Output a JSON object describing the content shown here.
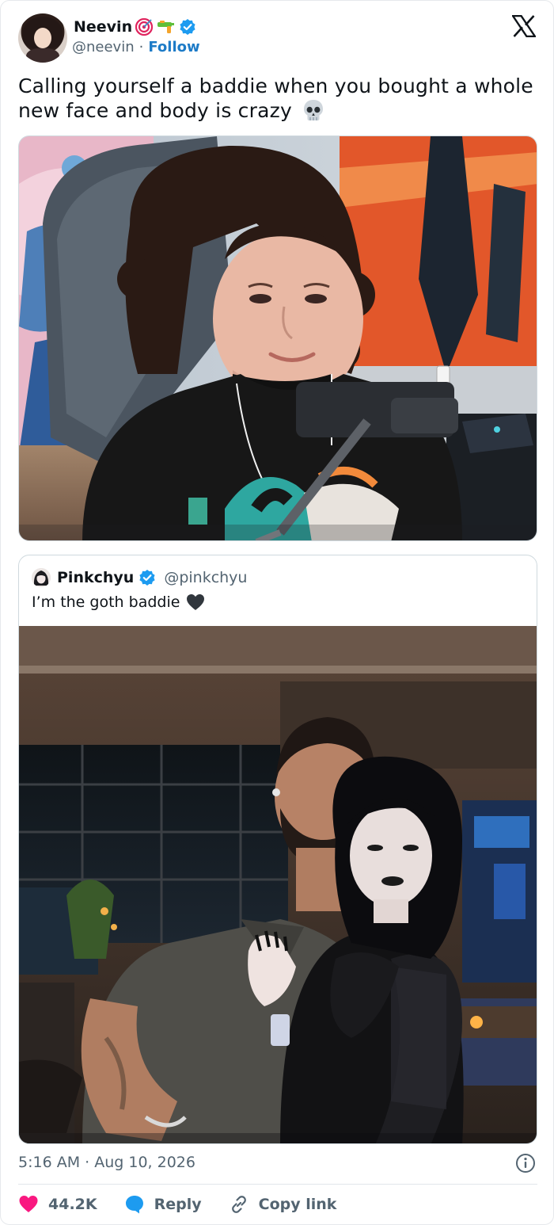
{
  "author": {
    "display_name": "Neevin",
    "handle": "@neevin",
    "separator": "·",
    "follow_label": "Follow"
  },
  "tweet": {
    "text": "Calling yourself a baddie when you bought a whole new face and body is crazy"
  },
  "quoted_tweet": {
    "display_name": "Pinkchyu",
    "handle": "@pinkchyu",
    "text": "I’m the goth baddie"
  },
  "meta": {
    "timestamp": "5:16 AM · Aug 10, 2026"
  },
  "actions": {
    "likes": "44.2K",
    "reply_label": "Reply",
    "copy_link_label": "Copy link"
  },
  "colors": {
    "like_red": "#f91880",
    "reply_blue": "#1d9bf0",
    "verified_blue": "#1d9bf0",
    "follow_blue": "#1d7bc7",
    "secondary_text": "#536471"
  },
  "icons": [
    "x-logo-icon",
    "verified-icon",
    "target-emoji-icon",
    "water-gun-emoji-icon",
    "skull-emoji-icon",
    "black-heart-icon",
    "info-icon",
    "heart-icon",
    "reply-bubble-icon",
    "link-icon"
  ]
}
